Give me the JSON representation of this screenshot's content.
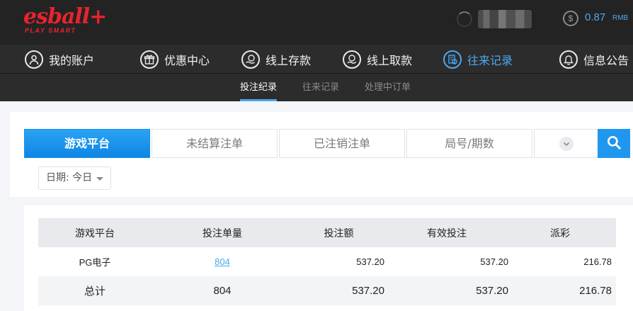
{
  "header": {
    "logo_text": "esball+",
    "logo_tagline": "PLAY SMART",
    "coin_symbol": "$",
    "balance": "0.87",
    "currency": "RMB"
  },
  "main_nav": [
    {
      "label": "我的账户",
      "icon": "user-icon",
      "active": false
    },
    {
      "label": "优惠中心",
      "icon": "gift-icon",
      "active": false
    },
    {
      "label": "线上存款",
      "icon": "deposit-icon",
      "active": false
    },
    {
      "label": "线上取款",
      "icon": "withdraw-icon",
      "active": false
    },
    {
      "label": "往来记录",
      "icon": "records-icon",
      "active": true
    },
    {
      "label": "信息公告",
      "icon": "bell-icon",
      "active": false
    }
  ],
  "sub_nav": [
    {
      "label": "投注纪录",
      "active": true
    },
    {
      "label": "往来记录",
      "active": false
    },
    {
      "label": "处理中订单",
      "active": false
    }
  ],
  "tabs": [
    {
      "label": "游戏平台",
      "active": true
    },
    {
      "label": "未结算注单",
      "active": false
    },
    {
      "label": "已注销注单",
      "active": false
    },
    {
      "label": "局号/期数",
      "active": false
    }
  ],
  "date_filter": {
    "label": "日期: 今日"
  },
  "table": {
    "headers": [
      "游戏平台",
      "投注单量",
      "投注额",
      "有效投注",
      "派彩"
    ],
    "rows": [
      {
        "platform": "PG电子",
        "count": "804",
        "bet": "537.20",
        "valid": "537.20",
        "payout": "216.78"
      }
    ],
    "total": {
      "label": "总计",
      "count": "804",
      "bet": "537.20",
      "valid": "537.20",
      "payout": "216.78"
    }
  },
  "colors": {
    "accent": "#4ba9ee",
    "brand_red": "#e8232e",
    "header_bg": "#232323"
  }
}
